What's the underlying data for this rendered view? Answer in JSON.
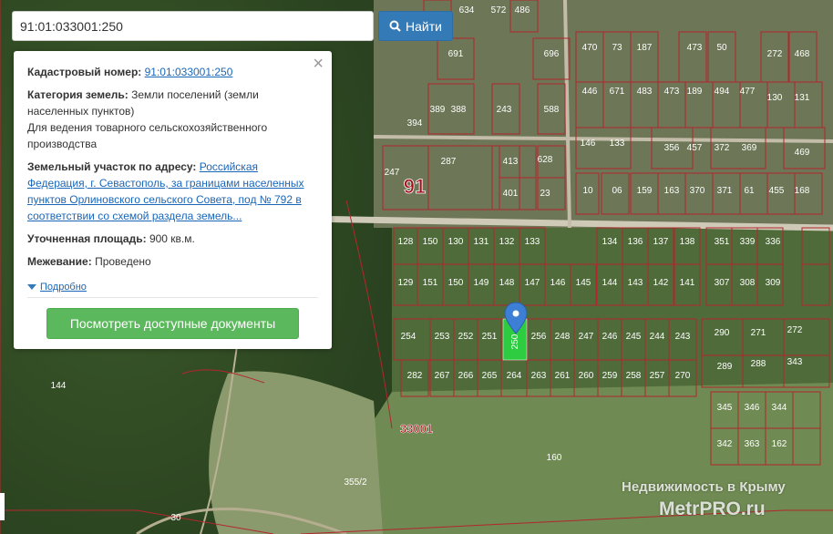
{
  "search": {
    "value": "91:01:033001:250",
    "button_label": "Найти",
    "button_icon": "search-icon"
  },
  "popup": {
    "cadastral_label": "Кадастровый номер:",
    "cadastral_value": "91:01:033001:250",
    "category_label": "Категория земель:",
    "category_value": "Земли поселений (земли населенных пунктов)",
    "category_use": "Для ведения товарного сельскохозяйственного производства",
    "address_label": "Земельный участок по адресу:",
    "address_value": "Российская Федерация, г. Севастополь, за границами населенных пунктов Орлиновского сельского Совета, под № 792 в соответствии со схемой раздела земель...",
    "area_label": "Уточненная площадь:",
    "area_value": "900 кв.м.",
    "survey_label": "Межевание:",
    "survey_value": "Проведено",
    "more_label": "Подробно",
    "docs_button": "Посмотреть доступные документы",
    "close_icon": "close-icon"
  },
  "map": {
    "block_label": "91",
    "quarter_label": "33001",
    "parcel_labels": [
      "486",
      "572",
      "634",
      "691",
      "696",
      "470",
      "73",
      "187",
      "473",
      "50",
      "272",
      "468",
      "394",
      "389",
      "388",
      "243",
      "588",
      "446",
      "671",
      "483",
      "473",
      "189",
      "494",
      "477",
      "130",
      "131",
      "146",
      "133",
      "356",
      "457",
      "372",
      "369",
      "469",
      "247",
      "287",
      "413",
      "628",
      "401",
      "23",
      "10",
      "06",
      "159",
      "163",
      "370",
      "371",
      "61",
      "455",
      "168",
      "128",
      "150",
      "130",
      "131",
      "132",
      "133",
      "134",
      "136",
      "137",
      "138",
      "351",
      "339",
      "336",
      "129",
      "151",
      "150",
      "149",
      "148",
      "147",
      "146",
      "145",
      "144",
      "143",
      "142",
      "141",
      "307",
      "308",
      "309",
      "254",
      "253",
      "252",
      "251",
      "256",
      "248",
      "247",
      "246",
      "245",
      "244",
      "243",
      "290",
      "271",
      "272",
      "282",
      "267",
      "266",
      "265",
      "264",
      "263",
      "261",
      "260",
      "259",
      "258",
      "257",
      "270",
      "289",
      "288",
      "343",
      "345",
      "346",
      "344",
      "342",
      "363",
      "162",
      "144",
      "160",
      "355/2",
      "30"
    ],
    "selected_parcel": "250",
    "colors": {
      "parcel_border": "#b3262e",
      "selected_fill": "#2ecc40",
      "marker": "#3d7fd4"
    }
  },
  "watermark": {
    "line1": "Недвижимость в Крыму",
    "line2": "MetrPRO.ru"
  }
}
